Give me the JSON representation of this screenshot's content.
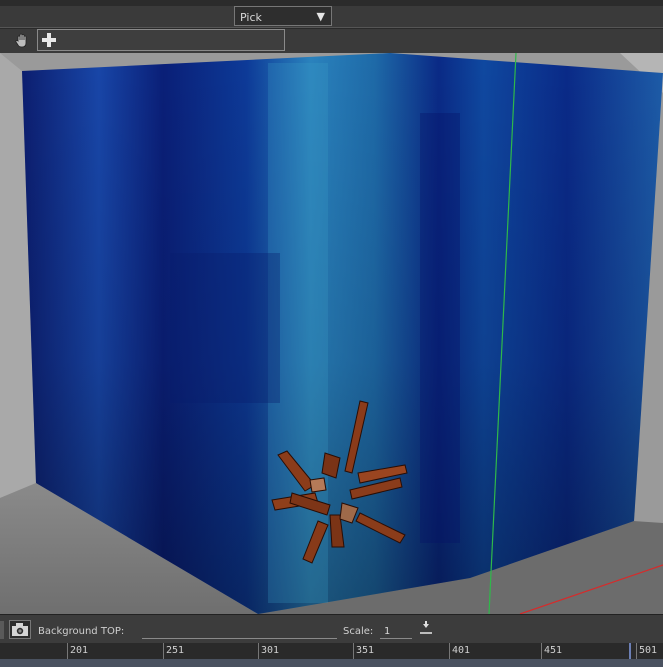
{
  "toolbar": {
    "mode_dropdown": {
      "selected": "Pick"
    },
    "search_value": ""
  },
  "viewport": {
    "colors": {
      "background": "#8f8f8f",
      "wall_blue_dark": "#0a1a6a",
      "wall_blue_light": "#2a8abf",
      "axis_green": "#2fb84a",
      "axis_red": "#d62b2b"
    }
  },
  "bottom_bar": {
    "background_top_label": "Background TOP:",
    "background_top_value": "",
    "scale_label": "Scale:",
    "scale_value": "1"
  },
  "timeline": {
    "ticks": [
      "201",
      "251",
      "301",
      "351",
      "401",
      "451",
      "501"
    ]
  }
}
